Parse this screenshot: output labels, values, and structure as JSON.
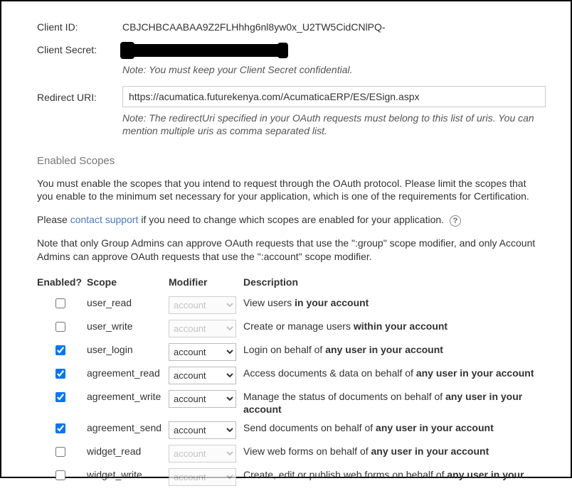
{
  "client_id": {
    "label": "Client ID:",
    "value": "CBJCHBCAABAA9Z2FLHhhg6nl8yw0x_U2TW5CidCNlPQ-"
  },
  "client_secret": {
    "label": "Client Secret:",
    "note": "Note: You must keep your Client Secret confidential."
  },
  "redirect_uri": {
    "label": "Redirect URI:",
    "value": "https://acumatica.futurekenya.com/AcumaticaERP/ES/ESign.aspx",
    "note": "Note: The redirectUri specified in your OAuth requests must belong to this list of uris. You can mention multiple uris as comma separated list."
  },
  "scopes_header": "Enabled Scopes",
  "scopes_intro": "You must enable the scopes that you intend to request through the OAuth protocol. Please limit the scopes that you enable to the minimum set necessary for your application, which is one of the requirements for Certification.",
  "scopes_contact_pre": "Please ",
  "scopes_contact_link": "contact support",
  "scopes_contact_post": " if you need to change which scopes are enabled for your application.   ",
  "scopes_admin_note": "Note that only Group Admins can approve OAuth requests that use the \":group\" scope modifier, and only Account Admins can approve OAuth requests that use the \":account\" scope modifier.",
  "columns": {
    "enabled": "Enabled?",
    "scope": "Scope",
    "modifier": "Modifier",
    "description": "Description"
  },
  "mod_options": [
    "account"
  ],
  "rows": [
    {
      "enabled": false,
      "scope": "user_read",
      "mod_active": false,
      "modifier": "account",
      "desc_pre": "View users ",
      "desc_bold": "in your account",
      "desc_post": ""
    },
    {
      "enabled": false,
      "scope": "user_write",
      "mod_active": false,
      "modifier": "account",
      "desc_pre": "Create or manage users ",
      "desc_bold": "within your account",
      "desc_post": ""
    },
    {
      "enabled": true,
      "scope": "user_login",
      "mod_active": true,
      "modifier": "account",
      "desc_pre": "Login on behalf of ",
      "desc_bold": "any user in your account",
      "desc_post": ""
    },
    {
      "enabled": true,
      "scope": "agreement_read",
      "mod_active": true,
      "modifier": "account",
      "desc_pre": "Access documents & data on behalf of ",
      "desc_bold": "any user in your account",
      "desc_post": ""
    },
    {
      "enabled": true,
      "scope": "agreement_write",
      "mod_active": true,
      "modifier": "account",
      "desc_pre": "Manage the status of documents on behalf of ",
      "desc_bold": "any user in your account",
      "desc_post": ""
    },
    {
      "enabled": true,
      "scope": "agreement_send",
      "mod_active": true,
      "modifier": "account",
      "desc_pre": "Send documents on behalf of ",
      "desc_bold": "any user in your account",
      "desc_post": ""
    },
    {
      "enabled": false,
      "scope": "widget_read",
      "mod_active": false,
      "modifier": "account",
      "desc_pre": "View web forms on behalf of ",
      "desc_bold": "any user in your account",
      "desc_post": ""
    },
    {
      "enabled": false,
      "scope": "widget_write",
      "mod_active": false,
      "modifier": "account",
      "desc_pre": "Create, edit or publish web forms on behalf of ",
      "desc_bold": "any user in your",
      "desc_post": ""
    }
  ]
}
